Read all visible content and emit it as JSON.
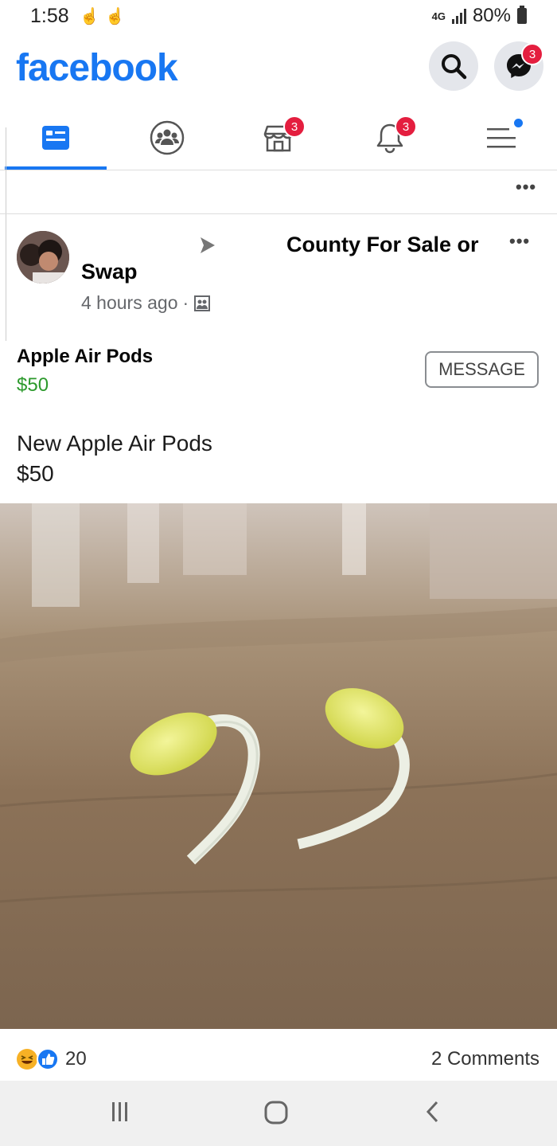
{
  "status_bar": {
    "time": "1:58",
    "network": "4G",
    "battery": "80%"
  },
  "header": {
    "logo": "facebook",
    "messenger_badge": "3",
    "icons": [
      "search-icon",
      "messenger-icon"
    ]
  },
  "tabs": [
    {
      "name": "news-feed",
      "icon": "news-feed-icon",
      "badge": ""
    },
    {
      "name": "groups",
      "icon": "groups-icon",
      "badge": ""
    },
    {
      "name": "marketplace",
      "icon": "marketplace-icon",
      "badge": "3"
    },
    {
      "name": "notifications",
      "icon": "bell-icon",
      "badge": "3"
    },
    {
      "name": "menu",
      "icon": "menu-icon",
      "badge": ""
    }
  ],
  "post": {
    "group_name_line1": "County For Sale or",
    "group_name_line2": "Swap",
    "time": "4 hours ago",
    "item_title": "Apple Air Pods",
    "item_price": "$50",
    "message_label": "MESSAGE",
    "description_line1": "New Apple Air Pods",
    "description_line2": "$50",
    "reaction_count": "20",
    "comments": "2 Comments"
  },
  "colors": {
    "brand": "#1877f2",
    "badge": "#e41e3f",
    "price": "#2d9a2d"
  }
}
